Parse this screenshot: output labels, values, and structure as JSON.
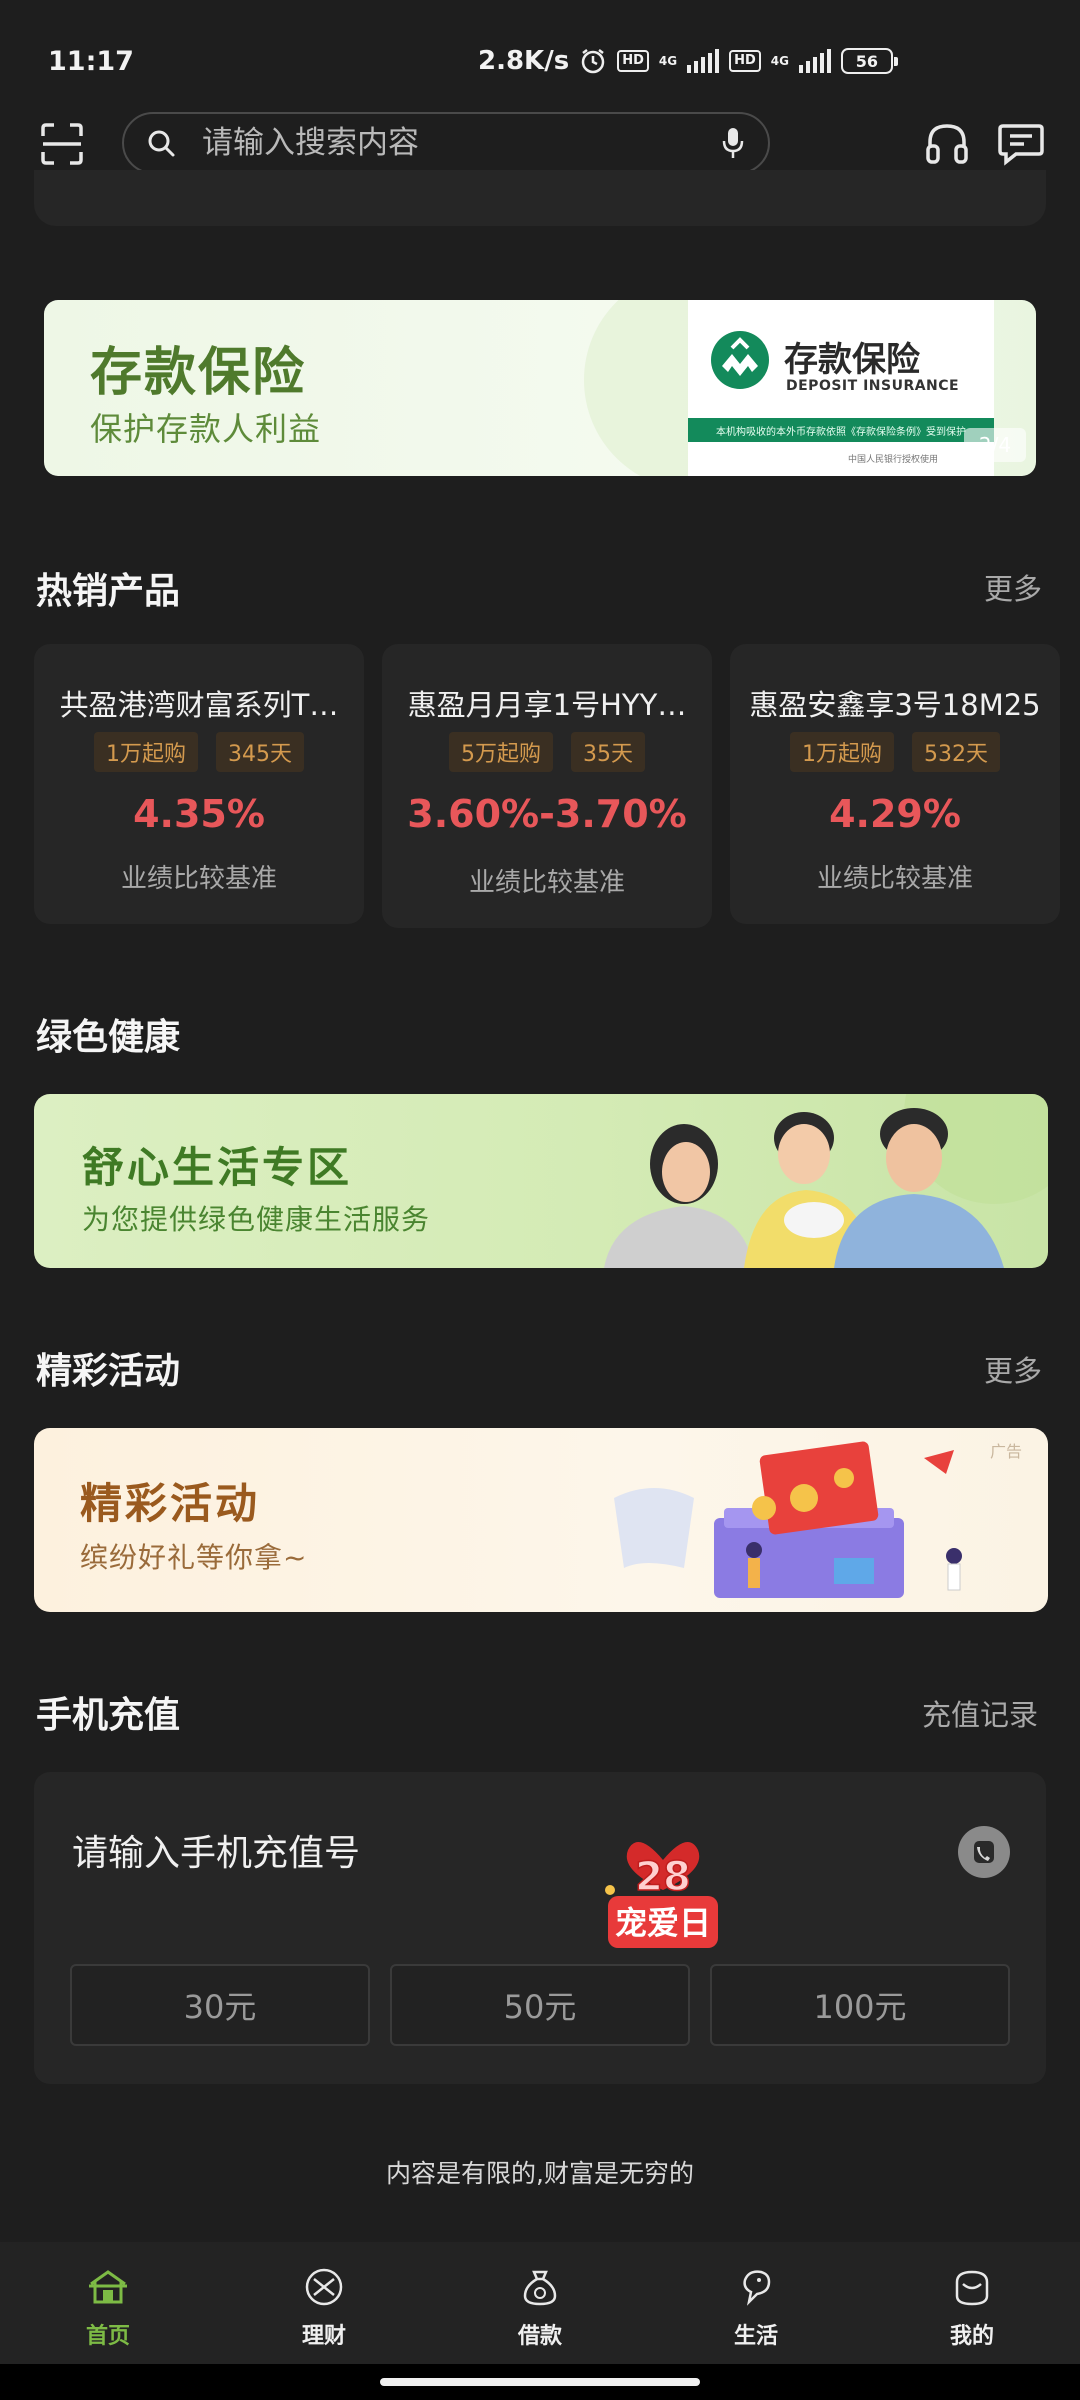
{
  "status_bar": {
    "time": "11:17",
    "speed": "2.8K/s",
    "sim1_hd": "HD",
    "sim1_net": "4G",
    "sim2_hd": "HD",
    "sim2_net": "4G",
    "battery": "56"
  },
  "search": {
    "placeholder": "请输入搜索内容"
  },
  "deposit_banner": {
    "title": "存款保险",
    "subtitle": "保护存款人利益",
    "logo_cn": "存款保险",
    "logo_en": "DEPOSIT INSURANCE",
    "strip_text": "本机构吸收的本外币存款依照《存款保险条例》受到保护",
    "footer": "中国人民银行授权使用",
    "pager": "2/4"
  },
  "hot_products": {
    "title": "热销产品",
    "more": "更多",
    "items": [
      {
        "name": "共盈港湾财富系列T…",
        "tag1": "1万起购",
        "tag2": "345天",
        "rate": "4.35%",
        "label": "业绩比较基准"
      },
      {
        "name": "惠盈月月享1号HYY…",
        "tag1": "5万起购",
        "tag2": "35天",
        "rate": "3.60%-3.70%",
        "label": "业绩比较基准"
      },
      {
        "name": "惠盈安鑫享3号18M25",
        "tag1": "1万起购",
        "tag2": "532天",
        "rate": "4.29%",
        "label": "业绩比较基准"
      }
    ]
  },
  "green_health": {
    "title": "绿色健康",
    "banner_title": "舒心生活专区",
    "banner_sub": "为您提供绿色健康生活服务"
  },
  "activities": {
    "title": "精彩活动",
    "more": "更多",
    "banner_title": "精彩活动",
    "banner_sub": "缤纷好礼等你拿~",
    "ad": "广告"
  },
  "recharge": {
    "title": "手机充值",
    "record": "充值记录",
    "input_placeholder": "请输入手机充值号",
    "promo_number": "28",
    "promo_text": "宠爱日",
    "amounts": [
      "30元",
      "50元",
      "100元"
    ]
  },
  "slogan": "内容是有限的,财富是无穷的",
  "bottom_nav": [
    {
      "label": "首页",
      "icon": "home-icon",
      "active": true
    },
    {
      "label": "理财",
      "icon": "finance-icon",
      "active": false
    },
    {
      "label": "借款",
      "icon": "loan-bag-icon",
      "active": false
    },
    {
      "label": "生活",
      "icon": "life-icon",
      "active": false
    },
    {
      "label": "我的",
      "icon": "profile-icon",
      "active": false
    }
  ],
  "colors": {
    "background": "#1e1e1e",
    "card": "#262626",
    "accent_green": "#7dbb45",
    "rate_red": "#e8575a",
    "tag_orange": "#d49a4e"
  }
}
